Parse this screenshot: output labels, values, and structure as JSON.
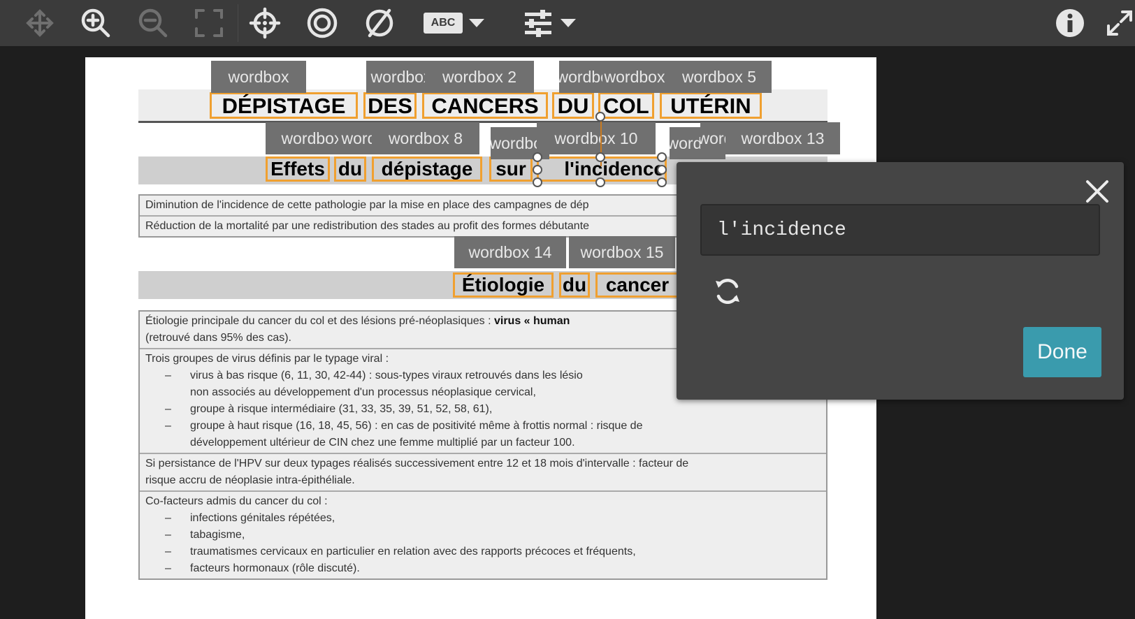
{
  "toolbar": {
    "icons": [
      "move-icon",
      "zoom-in-icon",
      "zoom-out-icon",
      "fit-screen-icon",
      "crosshair-icon",
      "target-icon",
      "no-symbol-icon",
      "abc-icon",
      "caret-down-icon",
      "sliders-icon",
      "info-icon",
      "fullscreen-icon"
    ],
    "abc_label": "ABC",
    "icon_color": "#e6e6e6",
    "disabled_color": "#6f6f6f"
  },
  "document": {
    "title_words": [
      "DÉPISTAGE",
      "DES",
      "CANCERS",
      "DU",
      "COL",
      "UTÉRIN"
    ],
    "section1_words": [
      "Effets",
      "du",
      "dépistage",
      "sur",
      "l'incidence"
    ],
    "section2_words": [
      "Étiologie",
      "du",
      "cancer"
    ],
    "wordbox_labels": [
      "wordbox",
      "wordbox",
      "wordbox 2",
      "wordbox",
      "wordbox",
      "wordbox 5",
      "wordbox",
      "wordbox",
      "wordbox 8",
      "wordbox",
      "wordbox 10",
      "wordbox",
      "wordbox",
      "wordbox 13",
      "wordbox 14",
      "wordbox 15"
    ],
    "table1": [
      "Diminution de l'incidence de cette pathologie par la mise en place des campagnes de dép",
      "Réduction de la mortalité par une redistribution des stades au profit des formes débutante"
    ],
    "table2": {
      "row1_prefix": "Étiologie principale du cancer du col et des lésions pré-néoplasiques : ",
      "row1_bold": "virus « human",
      "row1_line2": "(retrouvé dans 95% des cas).",
      "row2_title": "Trois groupes de virus définis par le typage viral :",
      "bullet_dash": "–",
      "row2_bullets": [
        "virus à bas risque (6, 11, 30, 42-44) : sous-types viraux retrouvés dans les lésio",
        "non associés au développement d'un processus néoplasique cervical,",
        "groupe à risque intermédiaire (31, 33, 35, 39, 51, 52, 58, 61),",
        "groupe à haut risque (16, 18, 45, 56) : en cas de positivité même à frottis normal : risque de",
        "développement ultérieur de CIN chez une femme multiplié par un facteur 100."
      ],
      "row3_line1": "Si persistance de l'HPV sur deux typages réalisés successivement entre 12 et 18 mois d'intervalle : facteur de",
      "row3_line2": "risque accru de néoplasie intra-épithéliale.",
      "row4_title": "Co-facteurs admis du cancer du col :",
      "row4_bullets": [
        "infections génitales répétées,",
        "tabagisme,",
        "traumatismes cervicaux en particulier en relation avec des rapports précoces et fréquents,",
        "facteurs hormonaux (rôle discuté)."
      ]
    },
    "highlight_color": "#f0a030"
  },
  "popup": {
    "input_value": "l'incidence",
    "done_label": "Done",
    "done_color": "#3a9bad"
  }
}
